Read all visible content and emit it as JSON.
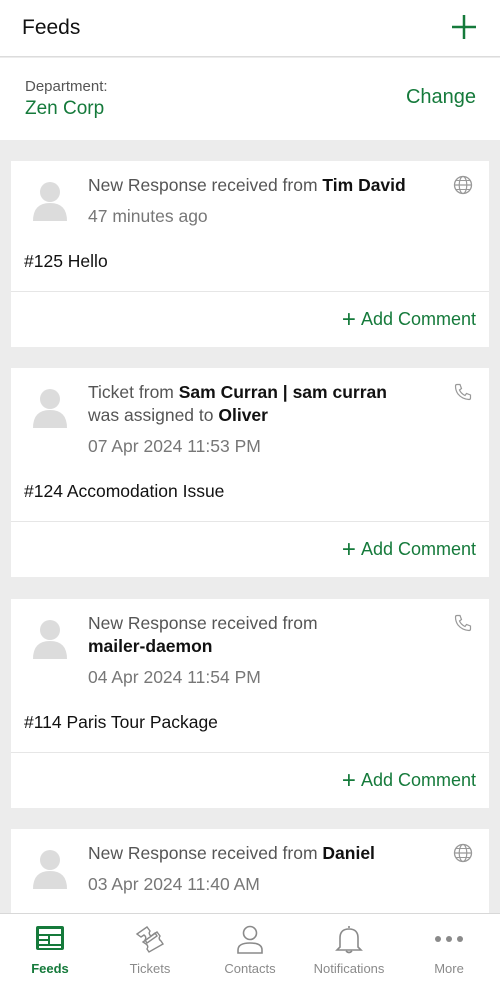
{
  "header": {
    "title": "Feeds"
  },
  "department": {
    "label": "Department:",
    "value": "Zen Corp",
    "change_label": "Change"
  },
  "feeds": [
    {
      "prefix": "New Response received from ",
      "name": "Tim David",
      "time": "47 minutes ago",
      "channel_icon": "globe-icon",
      "subject": "#125 Hello",
      "add_comment": "Add Comment"
    },
    {
      "prefix": "Ticket from ",
      "name": "Sam Curran | sam curran",
      "middle": "was assigned to ",
      "assignee": "Oliver",
      "time": "07 Apr 2024 11:53 PM",
      "channel_icon": "phone-icon",
      "subject": "#124 Accomodation Issue",
      "add_comment": "Add Comment"
    },
    {
      "prefix": "New Response received from",
      "name": "mailer-daemon",
      "time": "04 Apr 2024 11:54 PM",
      "channel_icon": "phone-icon",
      "subject": "#114 Paris Tour Package",
      "add_comment": "Add Comment"
    },
    {
      "prefix": "New Response received from ",
      "name": "Daniel",
      "time": "03 Apr 2024 11:40 AM",
      "channel_icon": "globe-icon"
    }
  ],
  "tabs": [
    {
      "label": "Feeds",
      "icon": "feeds-icon",
      "active": true
    },
    {
      "label": "Tickets",
      "icon": "tickets-icon",
      "active": false
    },
    {
      "label": "Contacts",
      "icon": "contacts-icon",
      "active": false
    },
    {
      "label": "Notifications",
      "icon": "bell-icon",
      "active": false
    },
    {
      "label": "More",
      "icon": "more-icon",
      "active": false
    }
  ],
  "colors": {
    "accent": "#157a3b",
    "background": "#ececec"
  }
}
